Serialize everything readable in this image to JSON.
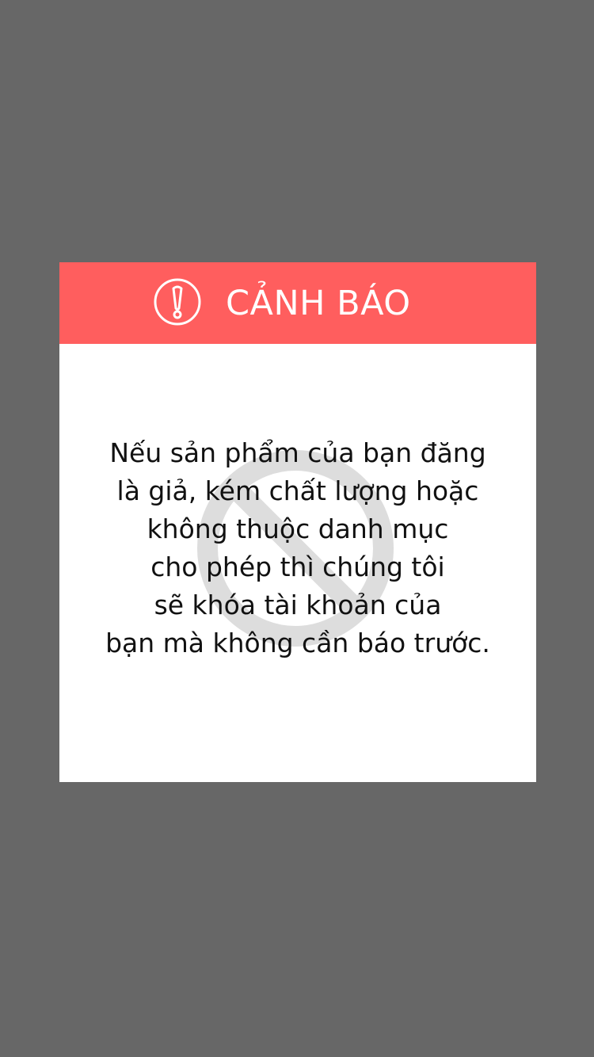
{
  "dialog": {
    "header": {
      "title": "CẢNH BÁO",
      "icon": "exclamation-circle-icon",
      "background_color": "#ff5e5e"
    },
    "body": {
      "watermark_icon": "prohibited-icon",
      "message_lines": [
        "Nếu sản phẩm của bạn đăng",
        "là giả, kém chất lượng hoặc",
        "không thuộc danh mục",
        "cho phép thì chúng tôi",
        "sẽ khóa tài khoản của",
        "bạn mà không cần báo trước."
      ]
    }
  },
  "colors": {
    "page_background": "#676767",
    "dialog_background": "#ffffff",
    "text": "#111111"
  }
}
